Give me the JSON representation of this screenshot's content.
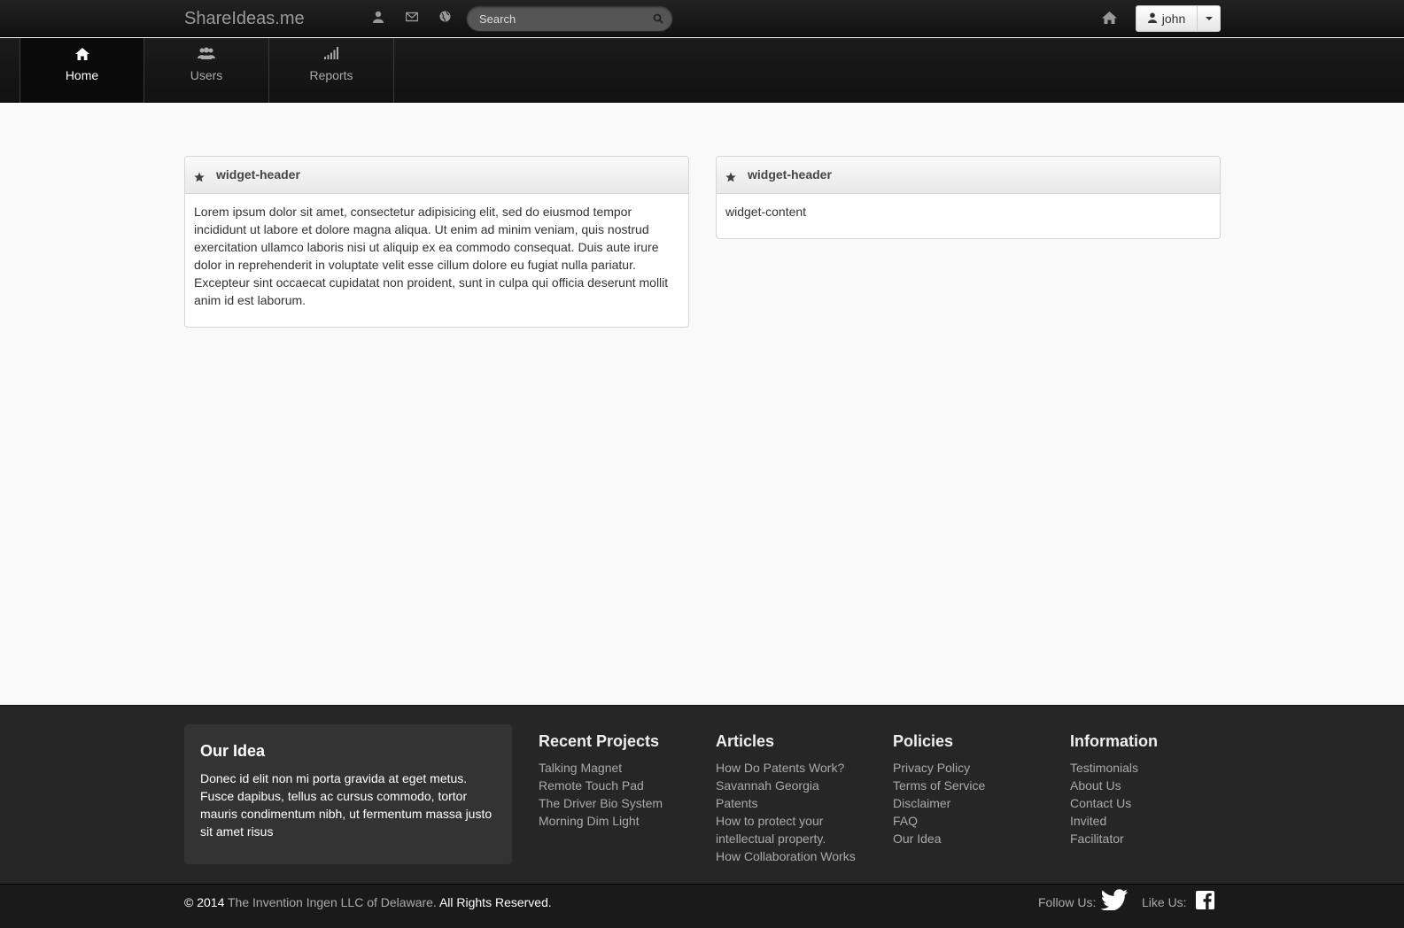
{
  "brand": "ShareIdeas.me",
  "search": {
    "placeholder": "Search"
  },
  "user": {
    "name": "john"
  },
  "subnav": [
    {
      "label": "Home",
      "icon": "home-icon"
    },
    {
      "label": "Users",
      "icon": "users-icon"
    },
    {
      "label": "Reports",
      "icon": "signal-icon"
    }
  ],
  "widgets": [
    {
      "header": "widget-header",
      "content": "Lorem ipsum dolor sit amet, consectetur adipisicing elit, sed do eiusmod tempor incididunt ut labore et dolore magna aliqua. Ut enim ad minim veniam, quis nostrud exercitation ullamco laboris nisi ut aliquip ex ea commodo consequat. Duis aute irure dolor in reprehenderit in voluptate velit esse cillum dolore eu fugiat nulla pariatur. Excepteur sint occaecat cupidatat non proident, sunt in culpa qui officia deserunt mollit anim id est laborum."
    },
    {
      "header": "widget-header",
      "content": "widget-content"
    }
  ],
  "footer": {
    "our_idea": {
      "title": "Our Idea",
      "text": "Donec id elit non mi porta gravida at eget metus. Fusce dapibus, tellus ac cursus commodo, tortor mauris condimentum nibh, ut fermentum massa justo sit amet risus"
    },
    "columns": [
      {
        "title": "Recent Projects",
        "links": [
          "Talking Magnet",
          "Remote Touch Pad",
          "The Driver Bio System",
          "Morning Dim Light"
        ]
      },
      {
        "title": "Articles",
        "links": [
          "How Do Patents Work?",
          "Savannah Georgia",
          "Patents",
          "How to protect your",
          "intellectual property.",
          "How Collaboration Works"
        ]
      },
      {
        "title": "Policies",
        "links": [
          "Privacy Policy",
          "Terms of Service",
          "Disclaimer",
          "FAQ",
          "Our Idea"
        ]
      },
      {
        "title": "Information",
        "links": [
          "Testimonials",
          "About Us",
          "Contact Us",
          "Invited",
          "Facilitator"
        ]
      }
    ],
    "copyright_prefix": "© 2014",
    "company": "The Invention Ingen LLC of Delaware.",
    "rights": "All Rights Reserved.",
    "follow_us": "Follow Us:",
    "like_us": "Like Us:"
  }
}
